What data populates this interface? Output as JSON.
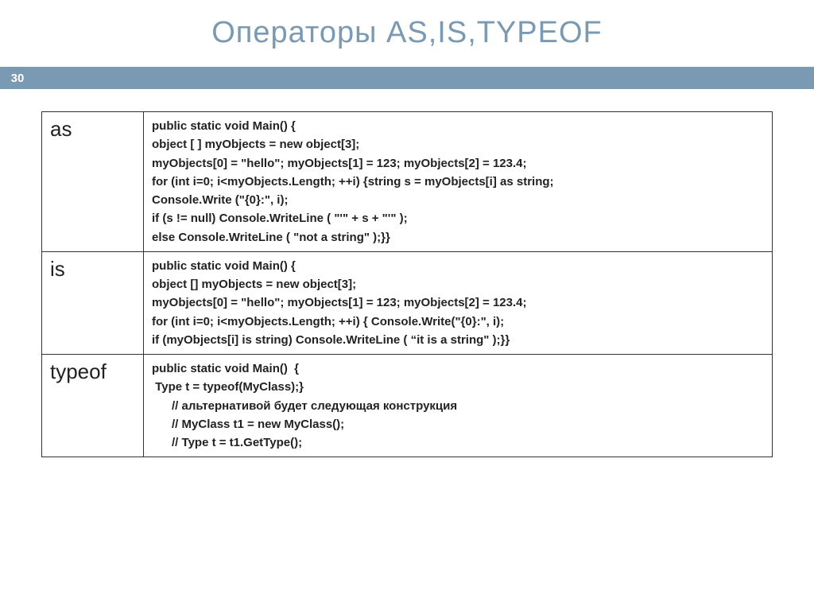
{
  "title": "Операторы AS,IS,TYPEOF",
  "page_number": "30",
  "rows": [
    {
      "name": "as",
      "code": [
        "public static void Main() {",
        "object [ ] myObjects = new object[3];",
        "myObjects[0] = \"hello\"; myObjects[1] = 123; myObjects[2] = 123.4;",
        "for (int i=0; i<myObjects.Length; ++i) {string s = myObjects[i] as string;",
        "Console.Write (\"{0}:\", i);",
        "if (s != null) Console.WriteLine ( \"'\" + s + \"'\" );",
        "else Console.WriteLine ( \"not a string\" );}}"
      ]
    },
    {
      "name": "is",
      "code": [
        "public static void Main() {",
        "object [] myObjects = new object[3];",
        "myObjects[0] = \"hello\"; myObjects[1] = 123; myObjects[2] = 123.4;",
        "for (int i=0; i<myObjects.Length; ++i) { Console.Write(\"{0}:\", i);",
        "if (myObjects[i] is string) Console.WriteLine ( “it is a string\" );}}"
      ]
    },
    {
      "name": "typeof",
      "code": [
        "public static void Main()  {",
        " Type t = typeof(MyClass);}",
        "      // альтернативой будет следующая конструкция",
        "      // MyClass t1 = new MyClass();",
        "      // Type t = t1.GetType();"
      ]
    }
  ]
}
